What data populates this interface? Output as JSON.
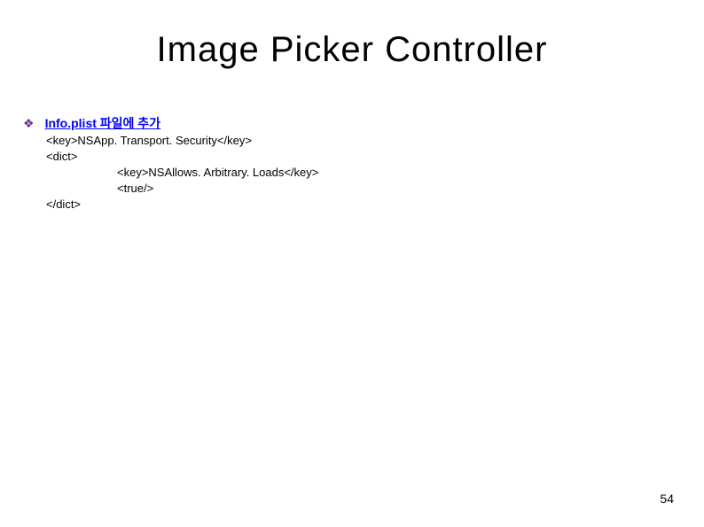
{
  "title": "Image Picker Controller",
  "bullet_symbol": "❖",
  "bullet_label": "Info.plist 파일에 추가",
  "code": {
    "line1": "<key>NSApp. Transport. Security</key>",
    "line2": "<dict>",
    "line3": "<key>NSAllows. Arbitrary. Loads</key>",
    "line4": "<true/>",
    "line5": "</dict>"
  },
  "page_number": "54"
}
